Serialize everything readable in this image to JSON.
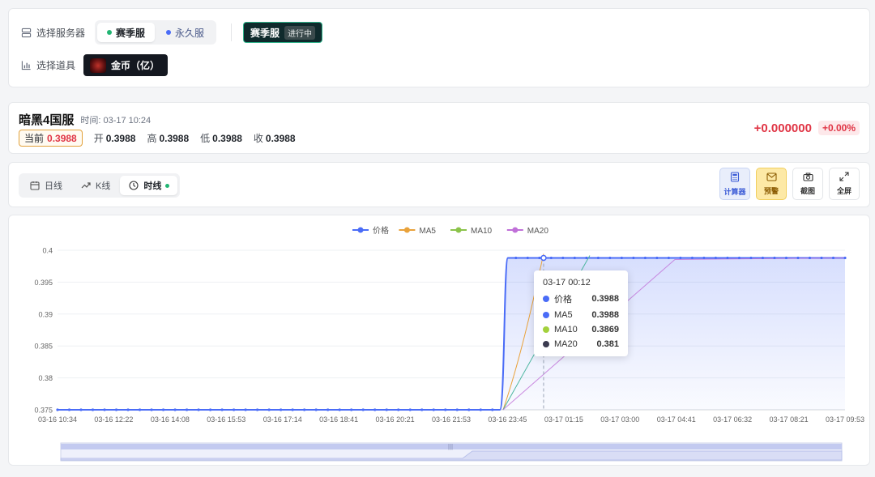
{
  "server": {
    "label": "选择服务器",
    "options": [
      {
        "label": "赛季服",
        "color": "#22b573"
      },
      {
        "label": "永久服",
        "color": "#4a6cf7"
      }
    ],
    "current": "赛季服",
    "status": "进行中"
  },
  "item": {
    "label": "选择道具",
    "name": "金币（亿）"
  },
  "quote": {
    "title": "暗黑4国服",
    "time": "时间: 03-17 10:24",
    "current_label": "当前",
    "current": "0.3988",
    "open_label": "开",
    "open": "0.3988",
    "high_label": "高",
    "high": "0.3988",
    "low_label": "低",
    "low": "0.3988",
    "close_label": "收",
    "close": "0.3988",
    "change": "+0.000000",
    "change_pct": "+0.00%"
  },
  "tabs": [
    {
      "label": "日线",
      "icon": "calendar-icon"
    },
    {
      "label": "K线",
      "icon": "trend-icon"
    },
    {
      "label": "时线",
      "icon": "clock-icon"
    }
  ],
  "tools": [
    {
      "label": "计算器",
      "icon": "calculator-icon"
    },
    {
      "label": "预警",
      "icon": "mail-icon"
    },
    {
      "label": "截图",
      "icon": "camera-icon"
    },
    {
      "label": "全屏",
      "icon": "expand-icon"
    }
  ],
  "tooltip": {
    "title": "03-17 00:12",
    "rows": [
      {
        "name": "价格",
        "value": "0.3988",
        "color": "#4a6cf7"
      },
      {
        "name": "MA5",
        "value": "0.3988",
        "color": "#4a6cf7"
      },
      {
        "name": "MA10",
        "value": "0.3869",
        "color": "#a3d13c"
      },
      {
        "name": "MA20",
        "value": "0.381",
        "color": "#3b3b4f"
      }
    ]
  },
  "chart_data": {
    "type": "line",
    "legend_position": "top-center",
    "grid": true,
    "series_colors": {
      "价格": "#4a6cf7",
      "MA5": "#e9a23b",
      "MA10": "#4db6a0",
      "MA20": "#c070d8"
    },
    "legend": [
      {
        "name": "价格",
        "color": "#4a6cf7"
      },
      {
        "name": "MA5",
        "color": "#e9a23b"
      },
      {
        "name": "MA10",
        "color": "#8bc34a"
      },
      {
        "name": "MA20",
        "color": "#c070d8"
      }
    ],
    "ylim": [
      0.375,
      0.4
    ],
    "yticks": [
      "0.4",
      "0.395",
      "0.39",
      "0.385",
      "0.38",
      "0.375"
    ],
    "xticks": [
      "03-16 10:34",
      "03-16 12:22",
      "03-16 14:08",
      "03-16 15:53",
      "03-16 17:14",
      "03-16 18:41",
      "03-16 20:21",
      "03-16 21:53",
      "03-16 23:45",
      "03-17 01:15",
      "03-17 03:00",
      "03-17 04:41",
      "03-17 06:32",
      "03-17 08:21",
      "03-17 09:53"
    ],
    "price": {
      "before": 0.375,
      "after": 0.3988,
      "jump_at_tick": 7.95
    },
    "ma5_end": 0.3988,
    "ma10_value": 0.3869,
    "ma20_value": 0.381
  }
}
